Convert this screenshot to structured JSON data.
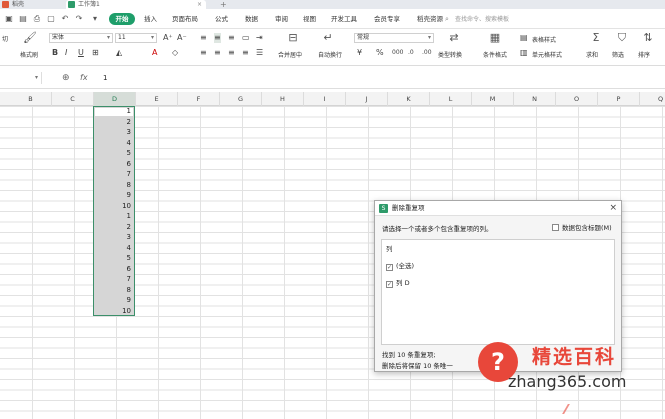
{
  "tabs": [
    {
      "label": "稻壳"
    },
    {
      "label": "工作簿1"
    }
  ],
  "menu": {
    "items": [
      "开始",
      "插入",
      "页面布局",
      "公式",
      "数据",
      "审阅",
      "视图",
      "开发工具",
      "会员专享",
      "稻壳资源"
    ],
    "search_placeholder": "查找命令、搜索模板"
  },
  "ribbon": {
    "cut": "切",
    "format_painter": "格式刷",
    "font_name": "宋体",
    "font_size": "11",
    "merge_center": "合并居中",
    "wrap_text": "自动换行",
    "number_format": "常规",
    "convert": "类型转换",
    "conditional_format": "条件格式",
    "table_style": "表格样式",
    "cell_style": "单元格样式",
    "sum": "求和",
    "filter": "筛选",
    "sort": "排序"
  },
  "formula_bar": {
    "fx": "fx",
    "value": "1"
  },
  "columns": [
    "B",
    "C",
    "D",
    "E",
    "F",
    "G",
    "H",
    "I",
    "J",
    "K",
    "L",
    "M",
    "N",
    "O",
    "P",
    "Q"
  ],
  "selected_column": "D",
  "column_d_values": [
    "1",
    "2",
    "3",
    "4",
    "5",
    "6",
    "7",
    "8",
    "9",
    "10",
    "1",
    "2",
    "3",
    "4",
    "5",
    "6",
    "7",
    "8",
    "9",
    "10"
  ],
  "dialog": {
    "title": "删除重复项",
    "prompt": "请选择一个或者多个包含重复项的列。",
    "header_checkbox": "数据包含标题(M)",
    "list_label": "列",
    "items": [
      {
        "label": "(全选)",
        "checked": true
      },
      {
        "label": "列 D",
        "checked": true
      }
    ],
    "found": "找到 10 条重复项;",
    "keep": "删除后将保留 10 条唯一"
  },
  "watermark": {
    "name": "精选百科",
    "url": "zhang365.com",
    "color": "#e8473a"
  },
  "colors": {
    "accent": "#1e9e6a",
    "selection_border": "#3c8f6a"
  }
}
